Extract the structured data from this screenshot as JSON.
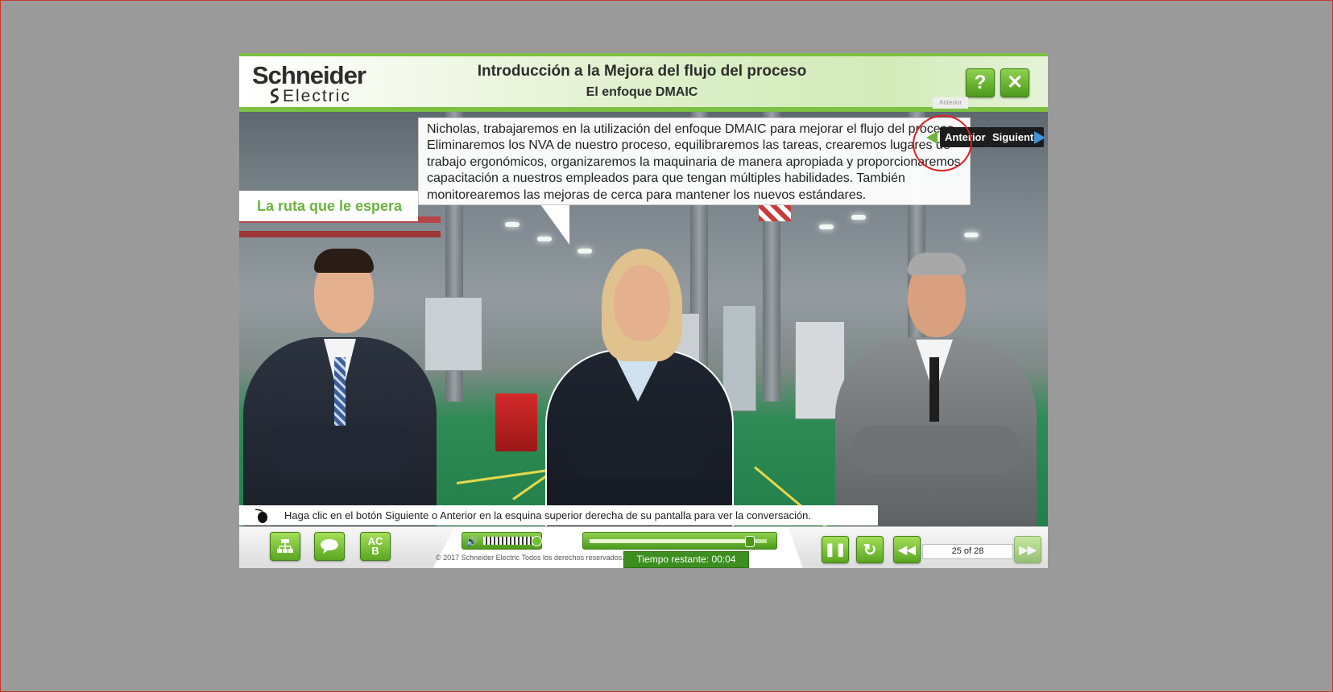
{
  "header": {
    "logo_line1": "Schneider",
    "logo_line2": "Electric",
    "title": "Introducción a la Mejora del flujo del proceso",
    "subtitle": "El enfoque DMAIC",
    "help_icon": "question-icon",
    "close_icon": "close-icon"
  },
  "scene": {
    "route_label": "La ruta que le espera",
    "bubble_text": "Nicholas, trabajaremos en la utilización del enfoque DMAIC para mejorar el flujo del proceso. Eliminaremos los NVA de nuestro proceso, equilibraremos las tareas, crearemos lugares de trabajo ergonómicos, organizaremos la maquinaria de manera apropiada y proporcionaremos capacitación a nuestros empleados para que tengan múltiples habilidades. También monitorearemos las mejoras de cerca para mantener los nuevos estándares."
  },
  "nav": {
    "prev_label": "Anterior",
    "next_label": "Siguiente",
    "tooltip": "Anterior"
  },
  "instruction": "Haga clic en el botón Siguiente o Anterior en la esquina superior derecha de su pantalla para ver la conversación.",
  "controls": {
    "glossary_label": "AC B",
    "copyright": "© 2017 Schneider Electric Todos los derechos reservados.",
    "time_remaining": "Tiempo restante:   00:04",
    "page_counter": "25 of 28",
    "progress": 0.9,
    "volume": 0.95
  },
  "colors": {
    "accent_green": "#7cc142",
    "button_green": "#5aa622",
    "annotation_red": "#e02020",
    "next_arrow_blue": "#3d95d8"
  }
}
